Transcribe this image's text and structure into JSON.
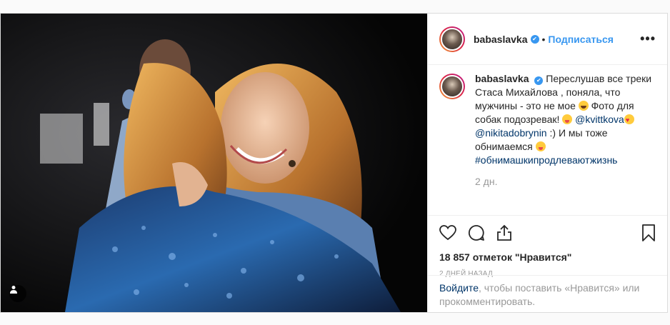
{
  "post": {
    "username": "babaslavka",
    "follow_label": "Подписаться",
    "more_label": "•••",
    "caption": {
      "username": "babaslavka",
      "text_1": "Переслушав все треки Стаса Михайлова , поняла, что мужчины - это не мое ",
      "text_2": " Фото для собак подозревак! ",
      "mention_1": "@kvittkova",
      "mention_2": "@nikitadobrynin",
      "text_3": " :) И мы тоже обнимаемся ",
      "hashtag": "#обнимашкипродлеваютжизнь",
      "emojis": [
        "laugh-emoji",
        "tongue-emoji",
        "love-emoji",
        "tongue-emoji"
      ]
    },
    "time_ago": "2 дн.",
    "likes_label": "18 857 отметок \"Нравится\"",
    "date_label": "2 ДНЕЙ НАЗАД",
    "login_prompt": {
      "link": "Войдите",
      "text": ", чтобы поставить «Нравится» или прокомментировать."
    },
    "icons": [
      "heart-icon",
      "comment-icon",
      "share-icon",
      "bookmark-icon",
      "user-tag-icon"
    ]
  }
}
